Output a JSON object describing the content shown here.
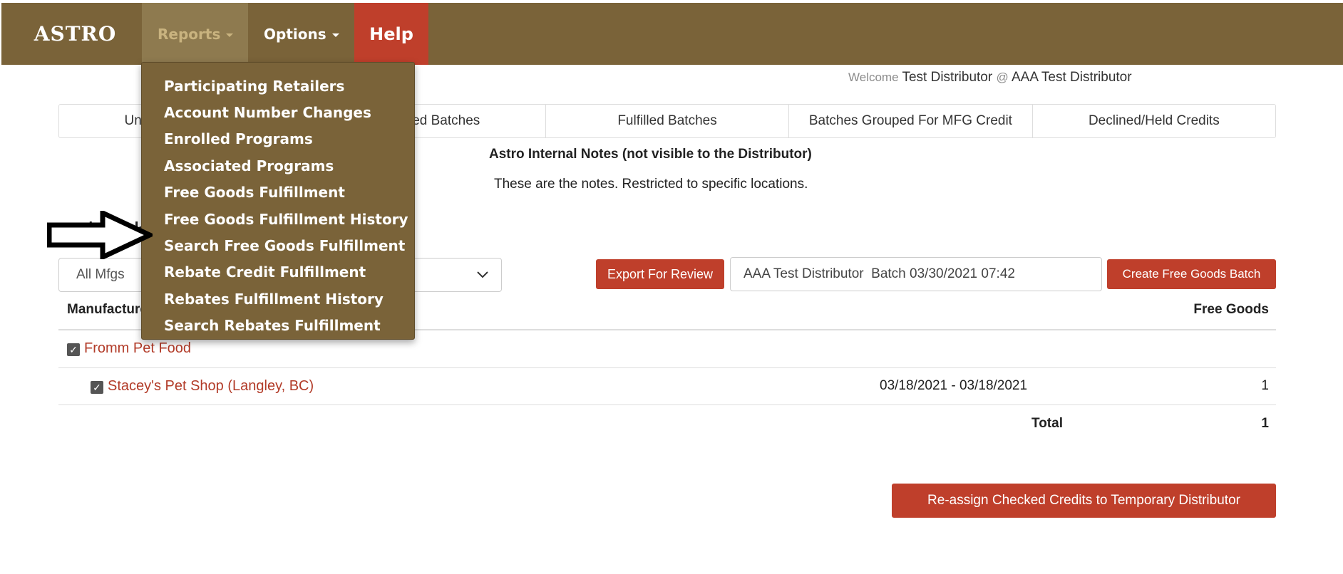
{
  "brand": "ASTRO",
  "nav": {
    "reports": "Reports",
    "options": "Options",
    "help": "Help"
  },
  "reports_menu": [
    "Participating Retailers",
    "Account Number Changes",
    "Enrolled Programs",
    "Associated Programs",
    "Free Goods Fulfillment",
    "Free Goods Fulfillment History",
    "Search Free Goods Fulfillment",
    "Rebate Credit Fulfillment",
    "Rebates Fulfillment History",
    "Search Rebates Fulfillment"
  ],
  "welcome": {
    "prefix": "Welcome",
    "user": "Test Distributor",
    "at": "@",
    "org": "AAA Test Distributor"
  },
  "tabs": [
    "Unbatched Credits",
    "Unfulfilled Batches",
    "Fulfilled Batches",
    "Batches Grouped For MFG Credit",
    "Declined/Held Credits"
  ],
  "notes": {
    "title": "Astro Internal Notes (not visible to the Distributor)",
    "body": "These are the notes. Restricted to specific locations."
  },
  "section_heading": "Unbatched Credits",
  "mfg_filter": {
    "value": "All Mfgs"
  },
  "actions": {
    "export": "Export For Review",
    "batch_name": "AAA Test Distributor  Batch 03/30/2021 07:42",
    "create_batch": "Create Free Goods Batch",
    "reassign": "Re-assign Checked Credits to Temporary Distributor"
  },
  "table": {
    "col_manufacturer": "Manufacturer",
    "col_free_goods": "Free Goods",
    "manufacturer": "Fromm Pet Food",
    "retailer": "Stacey's Pet Shop (Langley, BC)",
    "date_range": "03/18/2021 - 03/18/2021",
    "retailer_count": "1",
    "total_label": "Total",
    "total_value": "1"
  },
  "colors": {
    "navbar": "#7a6339",
    "accent_red": "#bf3f2b",
    "link": "#b23b28"
  }
}
